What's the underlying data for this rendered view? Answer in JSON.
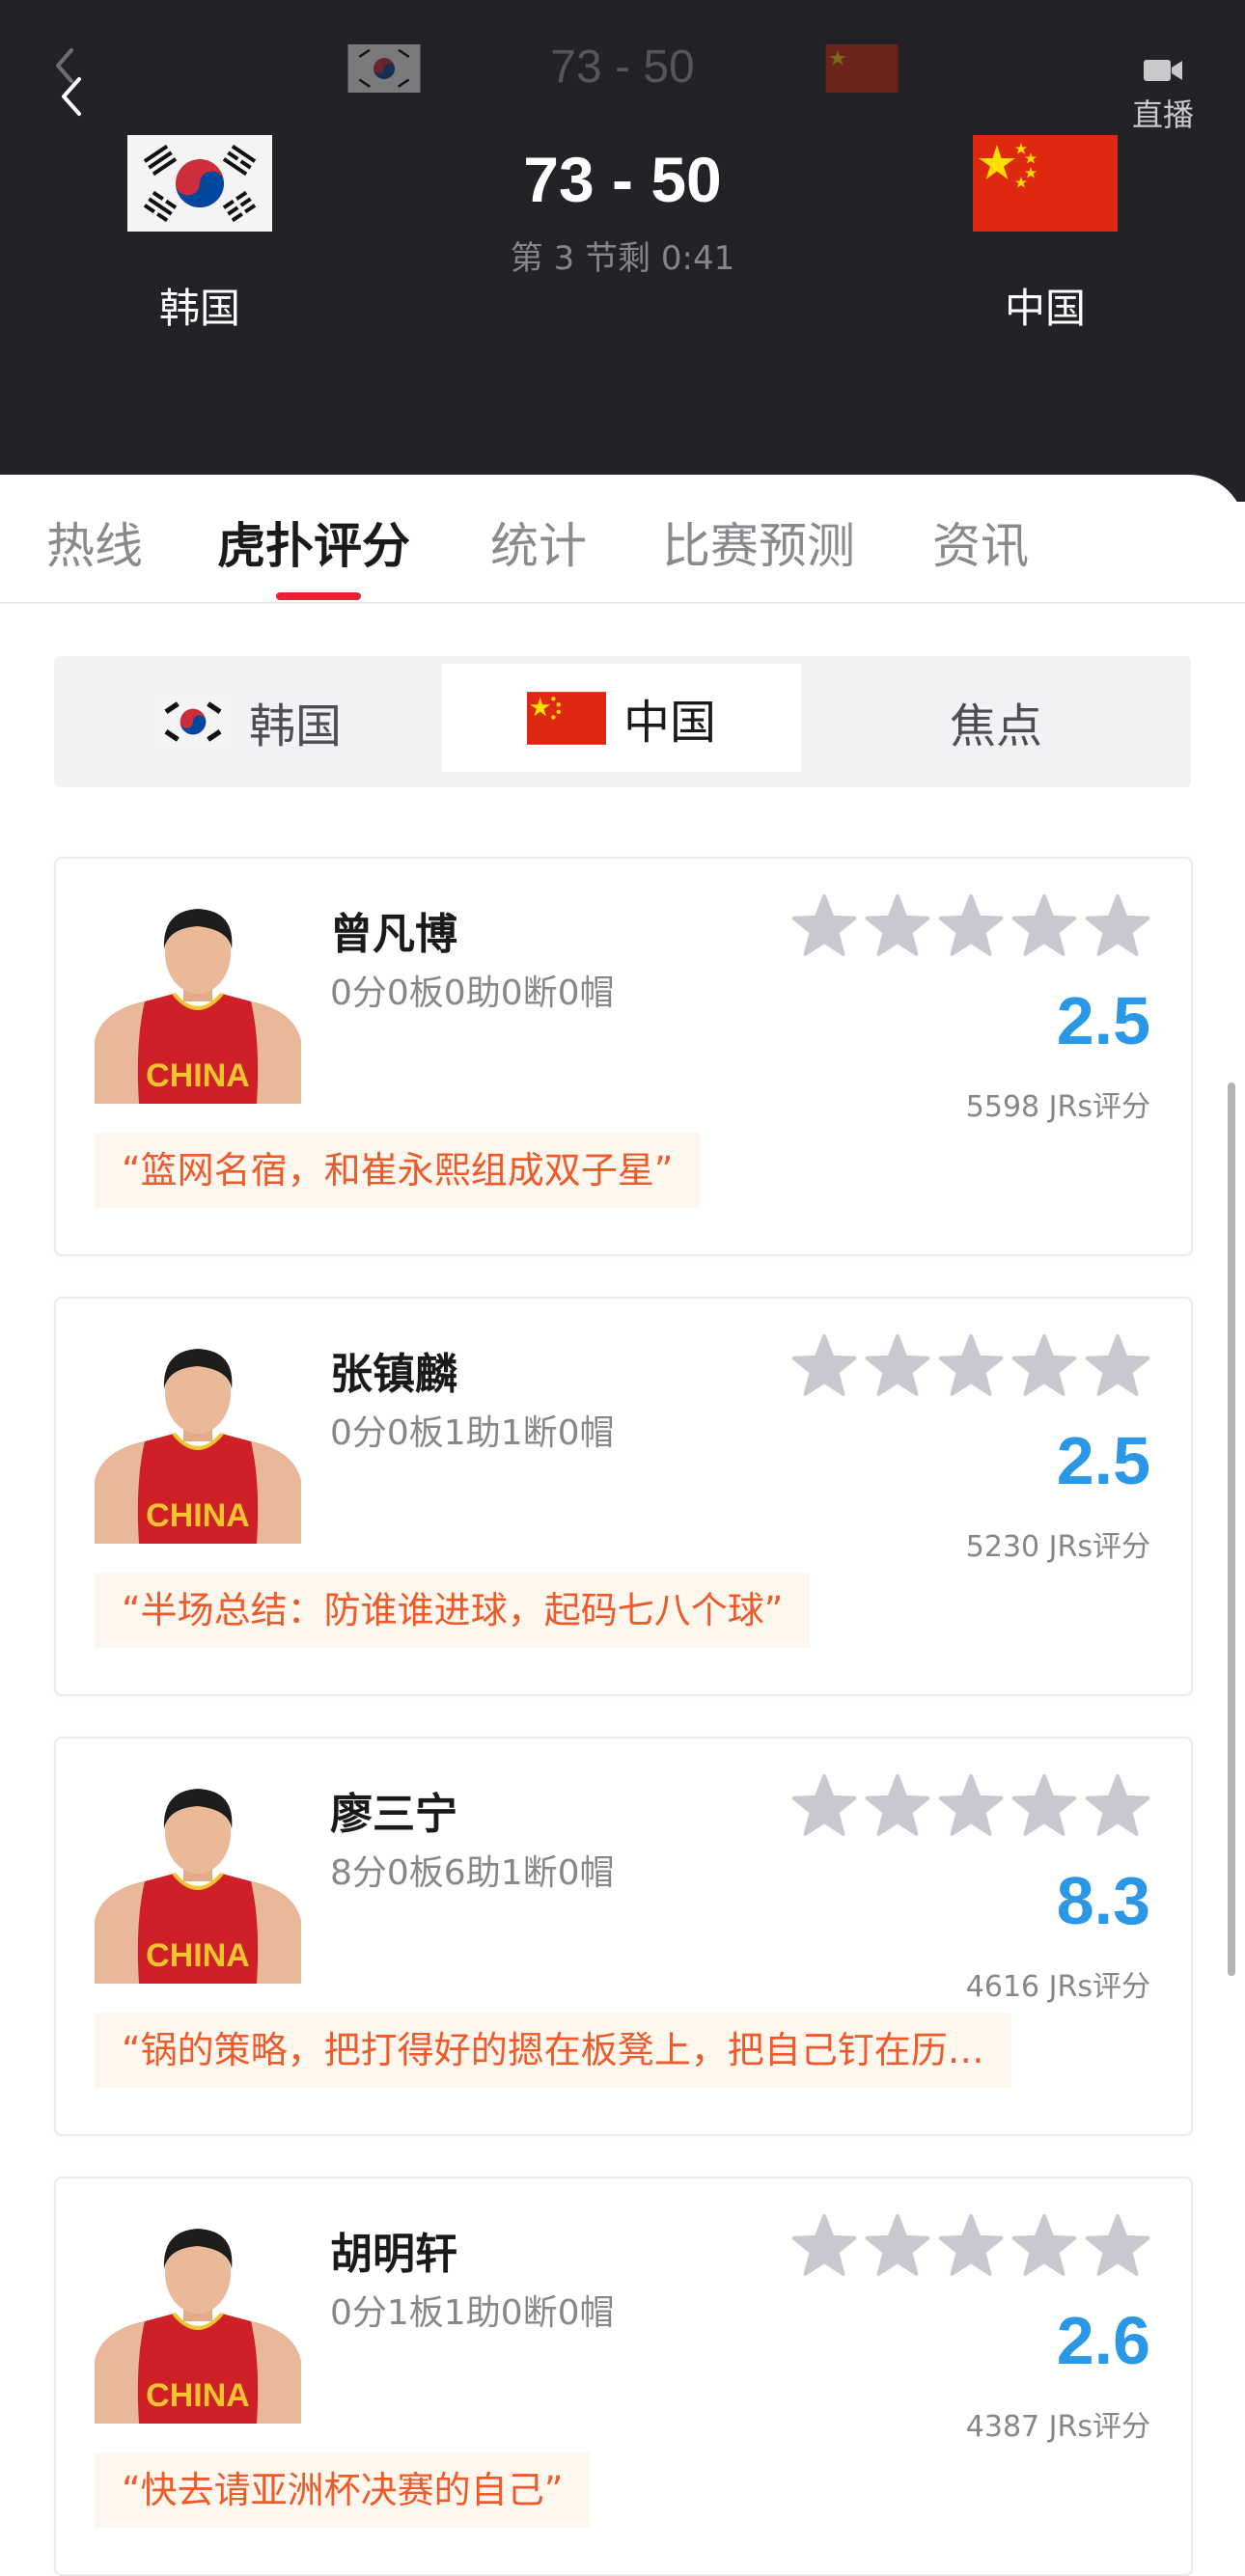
{
  "header": {
    "mini_score": "73 - 50",
    "score": "73 - 50",
    "period": "第 3 节剩 0:41",
    "home_team": "韩国",
    "away_team": "中国",
    "live_label": "直播"
  },
  "tabs": [
    {
      "label": "热线"
    },
    {
      "label": "虎扑评分",
      "active": true
    },
    {
      "label": "统计"
    },
    {
      "label": "比赛预测"
    },
    {
      "label": "资讯"
    }
  ],
  "segment": [
    {
      "label": "韩国",
      "flag": "korea-flag-icon"
    },
    {
      "label": "中国",
      "flag": "china-flag-icon",
      "active": true
    },
    {
      "label": "焦点"
    }
  ],
  "players": [
    {
      "name": "曾凡博",
      "stats": "0分0板0助0断0帽",
      "rating": "2.5",
      "rating_count": "5598 JRs评分",
      "quote": "“篮网名宿，和崔永熙组成双子星”"
    },
    {
      "name": "张镇麟",
      "stats": "0分0板1助1断0帽",
      "rating": "2.5",
      "rating_count": "5230 JRs评分",
      "quote": "“半场总结：防谁谁进球，起码七八个球”"
    },
    {
      "name": "廖三宁",
      "stats": "8分0板6助1断0帽",
      "rating": "8.3",
      "rating_count": "4616 JRs评分",
      "quote": "“锅的策略，把打得好的摁在板凳上，把自己钉在历…"
    },
    {
      "name": "胡明轩",
      "stats": "0分1板1助0断0帽",
      "rating": "2.6",
      "rating_count": "4387 JRs评分",
      "quote": "“快去请亚洲杯决赛的自己”"
    }
  ],
  "colors": {
    "header_bg": "#222227",
    "accent_red": "#e5222f",
    "rating_blue": "#2a98e6",
    "quote_orange": "#ee5a2a",
    "quote_bg": "#fef7ee",
    "star_gray": "#c8c8d0"
  }
}
